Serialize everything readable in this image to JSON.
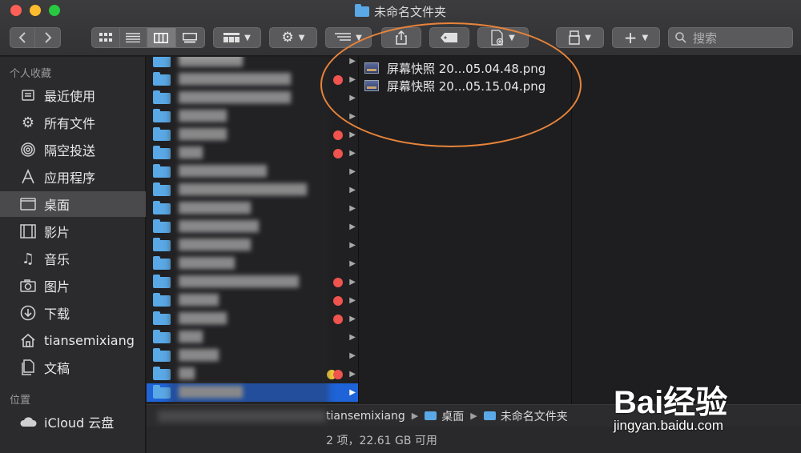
{
  "window": {
    "title": "未命名文件夹"
  },
  "search": {
    "placeholder": "搜索"
  },
  "sidebar": {
    "favorites_header": "个人收藏",
    "places_header": "位置",
    "items": [
      {
        "label": "最近使用",
        "icon": "recents-icon"
      },
      {
        "label": "所有文件",
        "icon": "gear-icon"
      },
      {
        "label": "隔空投送",
        "icon": "airdrop-icon"
      },
      {
        "label": "应用程序",
        "icon": "applications-icon"
      },
      {
        "label": "桌面",
        "icon": "desktop-icon"
      },
      {
        "label": "影片",
        "icon": "movies-icon"
      },
      {
        "label": "音乐",
        "icon": "music-icon"
      },
      {
        "label": "图片",
        "icon": "pictures-icon"
      },
      {
        "label": "下载",
        "icon": "downloads-icon"
      },
      {
        "label": "tiansemixiang",
        "icon": "home-icon"
      },
      {
        "label": "文稿",
        "icon": "documents-icon"
      }
    ],
    "icloud": "iCloud 云盘"
  },
  "files": [
    {
      "name": "屏幕快照 20...05.04.48.png"
    },
    {
      "name": "屏幕快照 20...05.15.04.png"
    }
  ],
  "pathbar": {
    "items": [
      "tiansemixiang",
      "桌面",
      "未命名文件夹"
    ]
  },
  "status": {
    "text": "2 项，22.61 GB 可用"
  },
  "watermark": {
    "brand": "Bai经验",
    "url": "jingyan.baidu.com"
  },
  "colors": {
    "accent": "#1f63d8",
    "annotation": "#e8843a",
    "tag_red": "#f0544f",
    "tag_yellow": "#f7d23a"
  }
}
